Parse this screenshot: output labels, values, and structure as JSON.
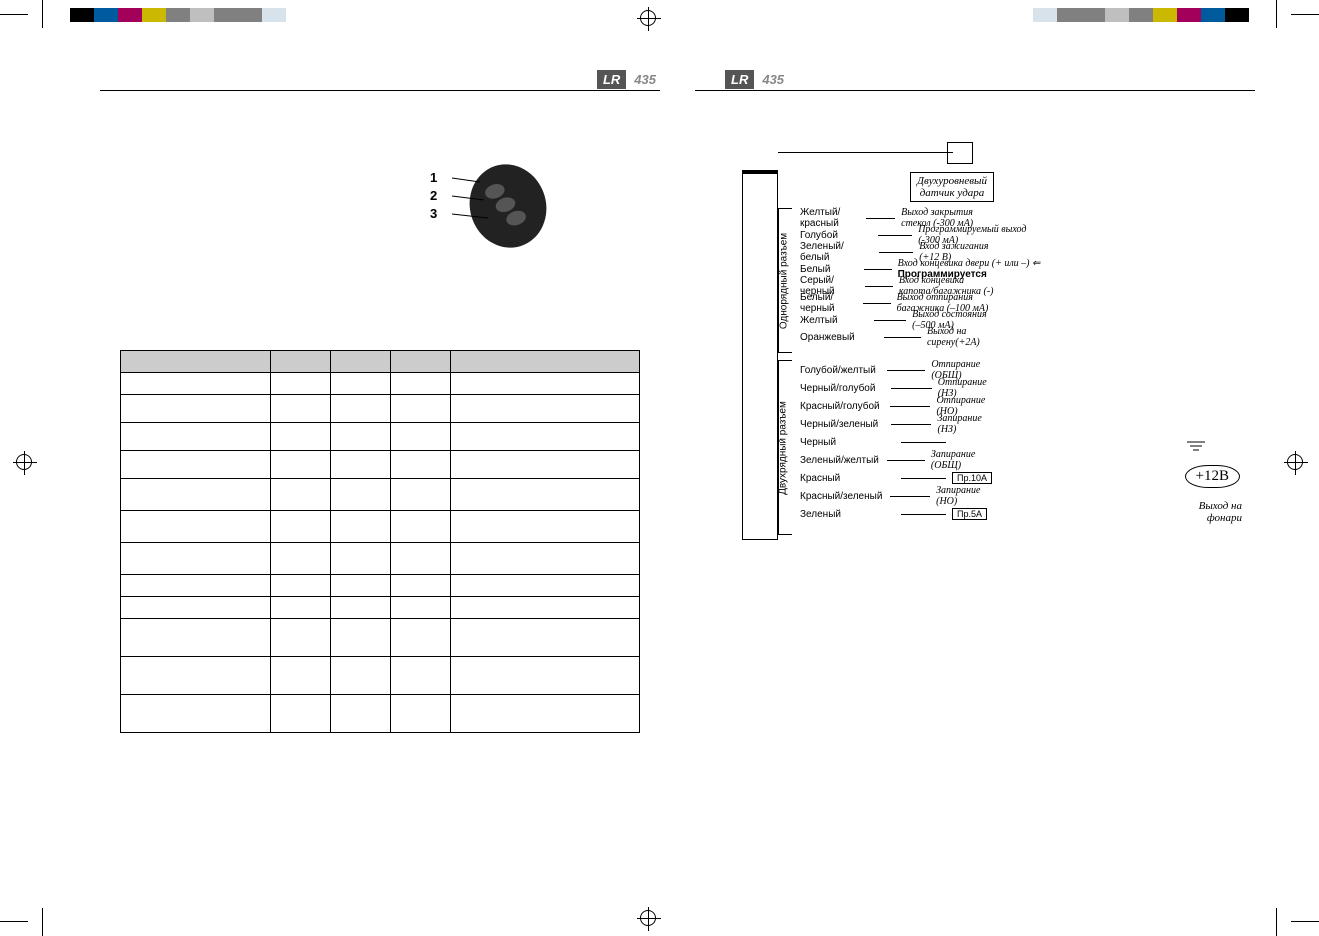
{
  "product": {
    "prefix": "LR",
    "model": "435"
  },
  "remote": {
    "btn1": "1",
    "btn2": "2",
    "btn3": "3"
  },
  "table": {
    "rows": [
      {
        "c0": "",
        "c1": "",
        "c2": "",
        "c3": "",
        "c4": ""
      },
      {
        "c0": "",
        "c1": "",
        "c2": "",
        "c3": "",
        "c4": ""
      },
      {
        "c0": "",
        "c1": "",
        "c2": "",
        "c3": "",
        "c4": ""
      },
      {
        "c0": "",
        "c1": "",
        "c2": "",
        "c3": "",
        "c4": ""
      },
      {
        "c0": "",
        "c1": "",
        "c2": "",
        "c3": "",
        "c4": ""
      },
      {
        "c0": "",
        "c1": "",
        "c2": "",
        "c3": "",
        "c4": ""
      },
      {
        "c0": "",
        "c1": "",
        "c2": "",
        "c3": "",
        "c4": ""
      },
      {
        "c0": "",
        "c1": "",
        "c2": "",
        "c3": "",
        "c4": ""
      },
      {
        "c0": "",
        "c1": "",
        "c2": "",
        "c3": "",
        "c4": ""
      },
      {
        "c0": "",
        "c1": "",
        "c2": "",
        "c3": "",
        "c4": ""
      },
      {
        "c0": "",
        "c1": "",
        "c2": "",
        "c3": "",
        "c4": ""
      },
      {
        "c0": "",
        "c1": "",
        "c2": "",
        "c3": "",
        "c4": ""
      }
    ]
  },
  "diagram": {
    "sensor_line1": "Двухуровневый",
    "sensor_line2": "датчик удара",
    "single_label": "Однорядный разъем",
    "double_label": "Двухрядный разъем",
    "single_wires": [
      {
        "color": "Желтый/красный",
        "desc": "Выход закрытия стекол (-300 мА)"
      },
      {
        "color": "Голубой",
        "desc": "Программируемый выход (-300 мА)"
      },
      {
        "color": "Зеленый/белый",
        "desc": "Вход зажигания (+12 В)"
      },
      {
        "color": "Белый",
        "desc": "Вход концевика двери (+ или –) ⇐",
        "prog": "Программируется"
      },
      {
        "color": "Серый/черный",
        "desc": "Вход концевика капота/багажника (-)"
      },
      {
        "color": "Белый/черный",
        "desc": "Выход отпирания багажника (–100 мА)"
      },
      {
        "color": "Желтый",
        "desc": "Выход состояния (–500 мА)"
      },
      {
        "color": "Оранжевый",
        "desc": "Выход на сирену(+2A)"
      }
    ],
    "double_wires": [
      {
        "color": "Голубой/желтый",
        "desc": "Отпирание (ОБЩ)"
      },
      {
        "color": "Черный/голубой",
        "desc": "Отпирание (НЗ)"
      },
      {
        "color": "Красный/голубой",
        "desc": "Отпирание (НО)"
      },
      {
        "color": "Черный/зеленый",
        "desc": "Запирание (НЗ)"
      },
      {
        "color": "Черный",
        "desc": ""
      },
      {
        "color": "Зеленый/желтый",
        "desc": "Запирание (ОБЩ)"
      },
      {
        "color": "Красный",
        "fuse": "Пр.10А",
        "desc": ""
      },
      {
        "color": "Красный/зеленый",
        "desc": "Запирание (НО)"
      },
      {
        "color": "Зеленый",
        "fuse": "Пр.5А",
        "desc": ""
      }
    ],
    "plus12": "+12В",
    "out_lights_1": "Выход на",
    "out_lights_2": "фонари"
  }
}
